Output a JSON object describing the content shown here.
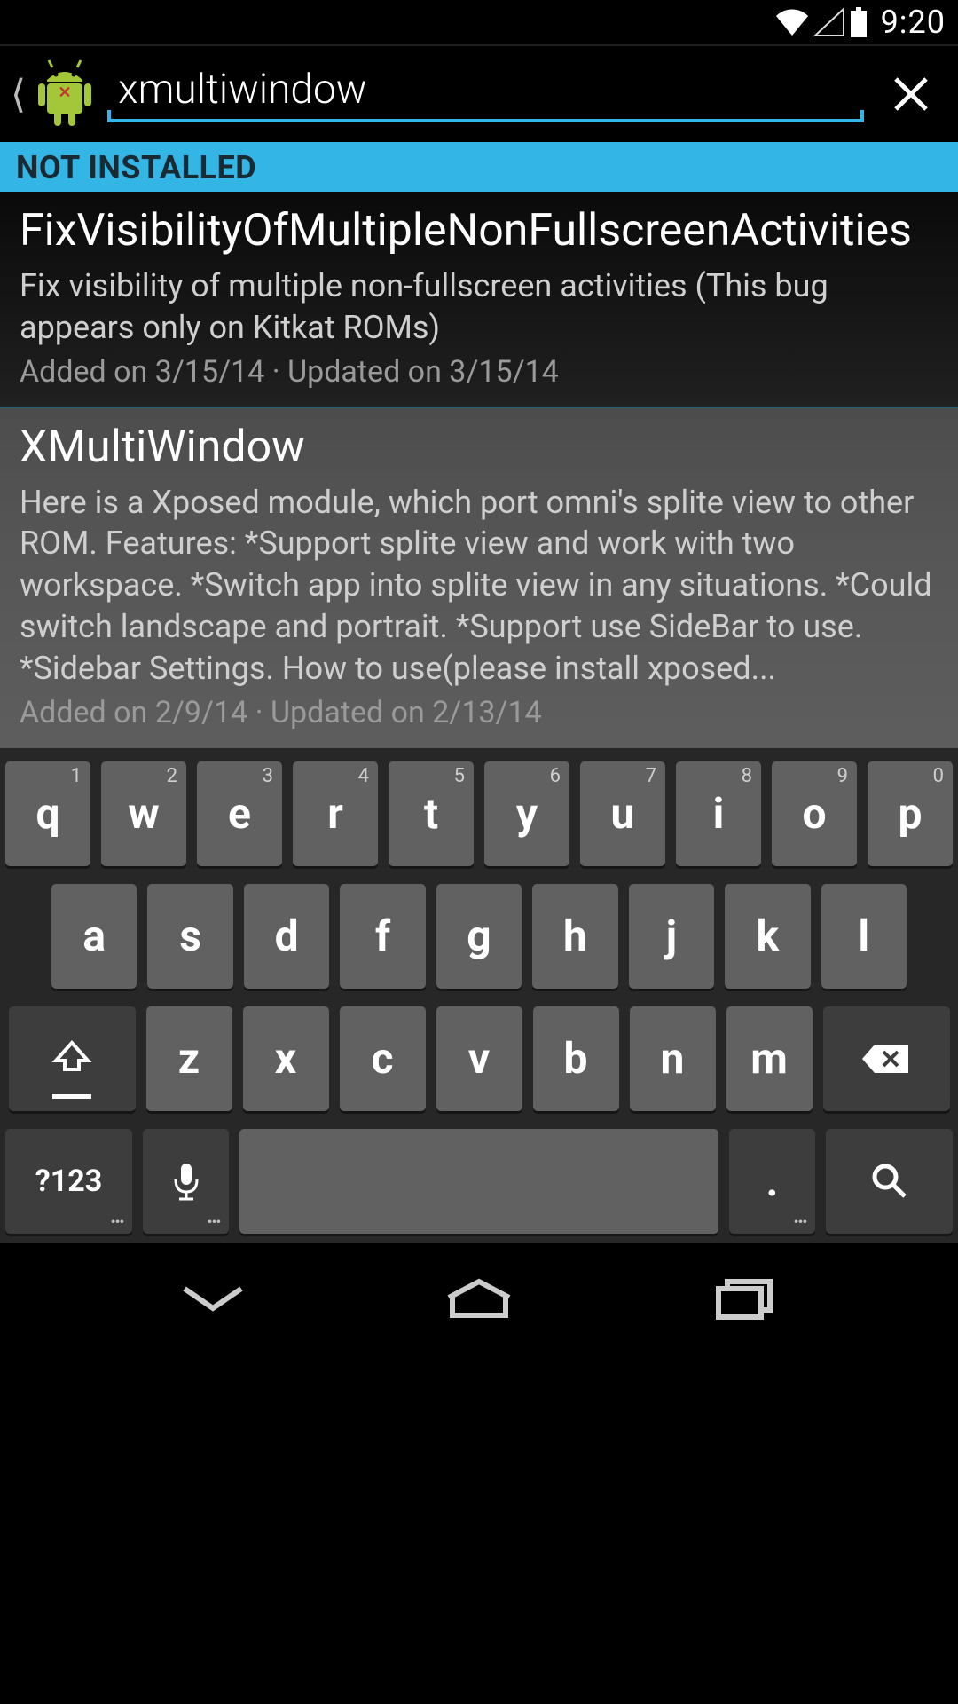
{
  "status_bar": {
    "time": "9:20"
  },
  "search": {
    "value": "xmultiwindow",
    "placeholder": ""
  },
  "section_header": "NOT INSTALLED",
  "results": [
    {
      "title": "FixVisibilityOfMultipleNonFullscreenActivities",
      "description": "Fix visibility of multiple non-fullscreen activities (This bug appears only on Kitkat ROMs)",
      "meta": "Added on 3/15/14 · Updated on 3/15/14",
      "selected": false
    },
    {
      "title": "XMultiWindow",
      "description": "Here is a Xposed module, which port omni's splite view to other ROM. Features: *Support splite view and work with two workspace. *Switch app into splite view in any situations. *Could switch landscape and portrait. *Support use SideBar to use. *Sidebar Settings. How to use(please install xposed...",
      "meta": "Added on 2/9/14 · Updated on 2/13/14",
      "selected": true
    }
  ],
  "keyboard": {
    "row1": [
      {
        "k": "q",
        "s": "1"
      },
      {
        "k": "w",
        "s": "2"
      },
      {
        "k": "e",
        "s": "3"
      },
      {
        "k": "r",
        "s": "4"
      },
      {
        "k": "t",
        "s": "5"
      },
      {
        "k": "y",
        "s": "6"
      },
      {
        "k": "u",
        "s": "7"
      },
      {
        "k": "i",
        "s": "8"
      },
      {
        "k": "o",
        "s": "9"
      },
      {
        "k": "p",
        "s": "0"
      }
    ],
    "row2": [
      "a",
      "s",
      "d",
      "f",
      "g",
      "h",
      "j",
      "k",
      "l"
    ],
    "row3": [
      "z",
      "x",
      "c",
      "v",
      "b",
      "n",
      "m"
    ],
    "symbol_key": "?123",
    "dot_key": "."
  }
}
